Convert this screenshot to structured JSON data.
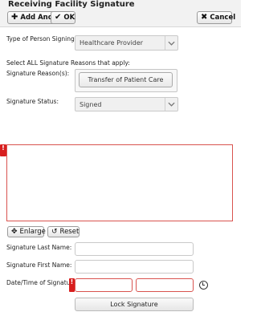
{
  "header": {
    "title": "Receiving Facility Signature",
    "add_another_label": "Add Another",
    "ok_label": "OK",
    "cancel_label": "Cancel"
  },
  "form": {
    "type_of_person_label": "Type of Person Signing:",
    "type_of_person_value": "Healthcare Provider",
    "select_all_reasons_label": "Select ALL Signature Reasons that apply:",
    "signature_reasons_label": "Signature Reason(s):",
    "signature_reason_button": "Transfer of Patient Care",
    "signature_status_label": "Signature Status:",
    "signature_status_value": "Signed",
    "error_marker": "!",
    "enlarge_label": "Enlarge",
    "reset_label": "Reset",
    "last_name_label": "Signature Last Name:",
    "last_name_value": "",
    "first_name_label": "Signature First Name:",
    "first_name_value": "",
    "datetime_label": "Date/Time of Signature:",
    "date_value": "",
    "time_value": "",
    "lock_signature_label": "Lock Signature"
  },
  "colors": {
    "error_red": "#d81e1e",
    "header_bg": "#f2f2f2"
  },
  "icons": {
    "add": "plus-icon",
    "ok": "checkmark-icon",
    "cancel": "close-icon",
    "enlarge": "expand-arrows-icon",
    "reset": "undo-icon",
    "dropdown": "chevron-down-icon",
    "time_picker": "clock-icon"
  }
}
